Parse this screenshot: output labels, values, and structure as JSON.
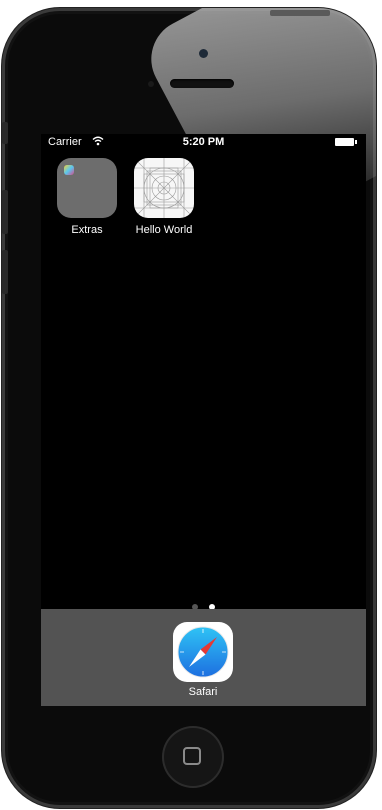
{
  "status_bar": {
    "carrier": "Carrier",
    "time": "5:20 PM"
  },
  "apps": [
    {
      "label": "Extras",
      "icon": "folder-icon"
    },
    {
      "label": "Hello World",
      "icon": "app-grid-template-icon"
    }
  ],
  "page_indicator": {
    "pages": 2,
    "current": 2
  },
  "dock": {
    "apps": [
      {
        "label": "Safari",
        "icon": "compass-icon"
      }
    ]
  },
  "colors": {
    "screen": "#000000",
    "dock": "#535353",
    "safari_blue": "#1e88e5",
    "needle_red": "#e53935"
  }
}
